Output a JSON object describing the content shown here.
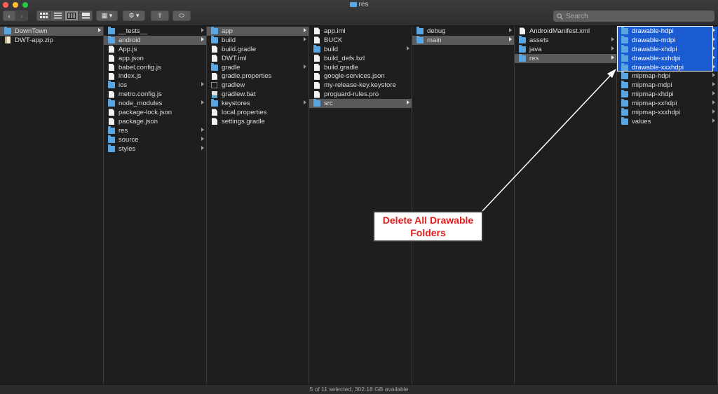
{
  "window": {
    "title": "res"
  },
  "toolbar": {
    "back_label": "‹",
    "forward_label": "›",
    "group_label": "▦ ▾",
    "action_label": "⚙ ▾",
    "share_label": "⇪",
    "tag_label": "⬭",
    "search_placeholder": "Search"
  },
  "columns": [
    {
      "items": [
        {
          "name": "DownTown",
          "kind": "folder",
          "state": "sel",
          "chevron": true
        },
        {
          "name": "DWT-app.zip",
          "kind": "zip"
        }
      ]
    },
    {
      "items": [
        {
          "name": "__tests__",
          "kind": "folder",
          "chevron": true
        },
        {
          "name": "android",
          "kind": "folder",
          "state": "sel",
          "chevron": true
        },
        {
          "name": "App.js",
          "kind": "file"
        },
        {
          "name": "app.json",
          "kind": "file"
        },
        {
          "name": "babel.config.js",
          "kind": "file"
        },
        {
          "name": "index.js",
          "kind": "file"
        },
        {
          "name": "ios",
          "kind": "folder",
          "chevron": true
        },
        {
          "name": "metro.config.js",
          "kind": "file"
        },
        {
          "name": "node_modules",
          "kind": "folder",
          "chevron": true
        },
        {
          "name": "package-lock.json",
          "kind": "file"
        },
        {
          "name": "package.json",
          "kind": "file"
        },
        {
          "name": "res",
          "kind": "folder",
          "chevron": true
        },
        {
          "name": "source",
          "kind": "folder",
          "chevron": true
        },
        {
          "name": "styles",
          "kind": "folder",
          "chevron": true
        }
      ]
    },
    {
      "items": [
        {
          "name": "app",
          "kind": "folder",
          "state": "sel",
          "chevron": true
        },
        {
          "name": "build",
          "kind": "folder",
          "chevron": true
        },
        {
          "name": "build.gradle",
          "kind": "file"
        },
        {
          "name": "DWT.iml",
          "kind": "file"
        },
        {
          "name": "gradle",
          "kind": "folder",
          "chevron": true
        },
        {
          "name": "gradle.properties",
          "kind": "file"
        },
        {
          "name": "gradlew",
          "kind": "terminal"
        },
        {
          "name": "gradlew.bat",
          "kind": "bat"
        },
        {
          "name": "keystores",
          "kind": "folder",
          "chevron": true
        },
        {
          "name": "local.properties",
          "kind": "file"
        },
        {
          "name": "settings.gradle",
          "kind": "file"
        }
      ]
    },
    {
      "items": [
        {
          "name": "app.iml",
          "kind": "file"
        },
        {
          "name": "BUCK",
          "kind": "file"
        },
        {
          "name": "build",
          "kind": "folder",
          "chevron": true
        },
        {
          "name": "build_defs.bzl",
          "kind": "file"
        },
        {
          "name": "build.gradle",
          "kind": "file"
        },
        {
          "name": "google-services.json",
          "kind": "file"
        },
        {
          "name": "my-release-key.keystore",
          "kind": "file"
        },
        {
          "name": "proguard-rules.pro",
          "kind": "file"
        },
        {
          "name": "src",
          "kind": "folder",
          "state": "sel",
          "chevron": true
        }
      ]
    },
    {
      "items": [
        {
          "name": "debug",
          "kind": "folder",
          "chevron": true
        },
        {
          "name": "main",
          "kind": "folder",
          "state": "sel",
          "chevron": true
        }
      ]
    },
    {
      "items": [
        {
          "name": "AndroidManifest.xml",
          "kind": "file"
        },
        {
          "name": "assets",
          "kind": "folder",
          "chevron": true
        },
        {
          "name": "java",
          "kind": "folder",
          "chevron": true
        },
        {
          "name": "res",
          "kind": "folder",
          "state": "sel",
          "chevron": true
        }
      ]
    },
    {
      "items": [
        {
          "name": "drawable-hdpi",
          "kind": "folder",
          "state": "hl",
          "chevron": true
        },
        {
          "name": "drawable-mdpi",
          "kind": "folder",
          "state": "hl",
          "chevron": true
        },
        {
          "name": "drawable-xhdpi",
          "kind": "folder",
          "state": "hl",
          "chevron": true
        },
        {
          "name": "drawable-xxhdpi",
          "kind": "folder",
          "state": "hl",
          "chevron": true
        },
        {
          "name": "drawable-xxxhdpi",
          "kind": "folder",
          "state": "hl",
          "chevron": true
        },
        {
          "name": "mipmap-hdpi",
          "kind": "folder",
          "chevron": true
        },
        {
          "name": "mipmap-mdpi",
          "kind": "folder",
          "chevron": true
        },
        {
          "name": "mipmap-xhdpi",
          "kind": "folder",
          "chevron": true
        },
        {
          "name": "mipmap-xxhdpi",
          "kind": "folder",
          "chevron": true
        },
        {
          "name": "mipmap-xxxhdpi",
          "kind": "folder",
          "chevron": true
        },
        {
          "name": "values",
          "kind": "folder",
          "chevron": true
        }
      ]
    }
  ],
  "status": {
    "text": "5 of 11 selected, 302.18 GB available"
  },
  "annotation": {
    "line1": "Delete All Drawable",
    "line2": "Folders",
    "color": "#e31c1c"
  },
  "colors": {
    "selection_blue": "#1b5bd1",
    "folder_blue": "#59a6e3",
    "selection_gray": "#5a5a5d"
  }
}
